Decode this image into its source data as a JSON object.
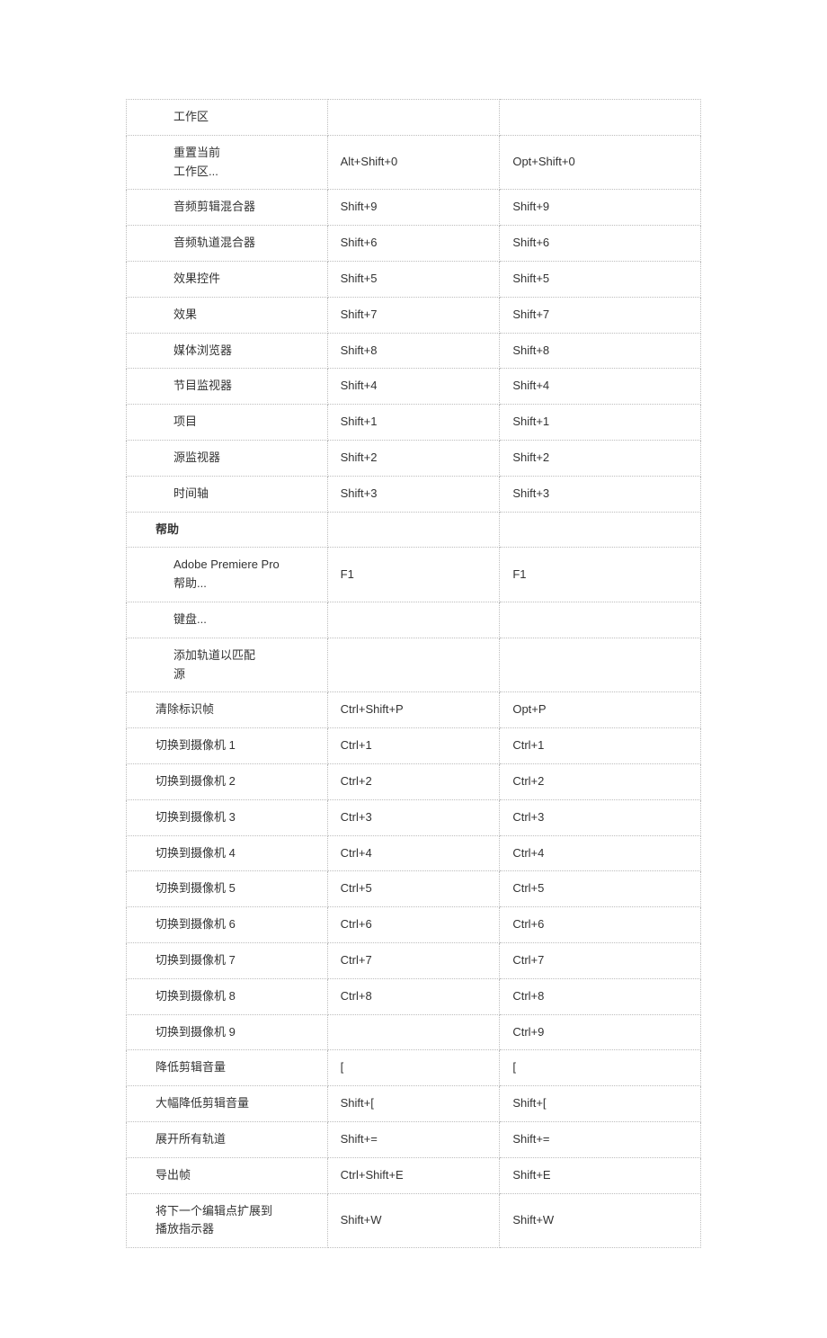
{
  "rows": [
    {
      "label": "工作区",
      "indent": 2,
      "win": "",
      "mac": ""
    },
    {
      "label": "重置当前\n工作区...",
      "indent": 2,
      "win": "Alt+Shift+0",
      "mac": "Opt+Shift+0"
    },
    {
      "label": "音频剪辑混合器",
      "indent": 2,
      "win": "Shift+9",
      "mac": "Shift+9"
    },
    {
      "label": "音频轨道混合器",
      "indent": 2,
      "win": "Shift+6",
      "mac": "Shift+6"
    },
    {
      "label": "效果控件",
      "indent": 2,
      "win": "Shift+5",
      "mac": "Shift+5"
    },
    {
      "label": "效果",
      "indent": 2,
      "win": "Shift+7",
      "mac": "Shift+7"
    },
    {
      "label": "媒体浏览器",
      "indent": 2,
      "win": "Shift+8",
      "mac": "Shift+8"
    },
    {
      "label": "节目监视器",
      "indent": 2,
      "win": "Shift+4",
      "mac": "Shift+4"
    },
    {
      "label": "项目",
      "indent": 2,
      "win": "Shift+1",
      "mac": "Shift+1"
    },
    {
      "label": "源监视器",
      "indent": 2,
      "win": "Shift+2",
      "mac": "Shift+2"
    },
    {
      "label": "时间轴",
      "indent": 2,
      "win": "Shift+3",
      "mac": "Shift+3"
    },
    {
      "label": "帮助",
      "indent": 1,
      "win": "",
      "mac": "",
      "bold": true
    },
    {
      "label": "Adobe Premiere Pro\n帮助...",
      "indent": 2,
      "win": "F1",
      "mac": "F1"
    },
    {
      "label": "键盘...",
      "indent": 2,
      "win": "",
      "mac": ""
    },
    {
      "label": "添加轨道以匹配\n源",
      "indent": 2,
      "win": "",
      "mac": ""
    },
    {
      "label": "清除标识帧",
      "indent": 1,
      "win": "Ctrl+Shift+P",
      "mac": "Opt+P"
    },
    {
      "label": "切换到摄像机 1",
      "indent": 1,
      "win": "Ctrl+1",
      "mac": "Ctrl+1"
    },
    {
      "label": "切换到摄像机 2",
      "indent": 1,
      "win": "Ctrl+2",
      "mac": "Ctrl+2"
    },
    {
      "label": "切换到摄像机 3",
      "indent": 1,
      "win": "Ctrl+3",
      "mac": "Ctrl+3"
    },
    {
      "label": "切换到摄像机 4",
      "indent": 1,
      "win": "Ctrl+4",
      "mac": "Ctrl+4"
    },
    {
      "label": "切换到摄像机 5",
      "indent": 1,
      "win": "Ctrl+5",
      "mac": "Ctrl+5"
    },
    {
      "label": "切换到摄像机 6",
      "indent": 1,
      "win": "Ctrl+6",
      "mac": "Ctrl+6"
    },
    {
      "label": "切换到摄像机 7",
      "indent": 1,
      "win": "Ctrl+7",
      "mac": "Ctrl+7"
    },
    {
      "label": "切换到摄像机 8",
      "indent": 1,
      "win": "Ctrl+8",
      "mac": "Ctrl+8"
    },
    {
      "label": "切换到摄像机 9",
      "indent": 1,
      "win": "",
      "mac": "Ctrl+9"
    },
    {
      "label": "降低剪辑音量",
      "indent": 1,
      "win": "[",
      "mac": "["
    },
    {
      "label": "大幅降低剪辑音量",
      "indent": 1,
      "win": "Shift+[",
      "mac": "Shift+["
    },
    {
      "label": " 展开所有轨道",
      "indent": 1,
      "win": "Shift+=",
      "mac": "Shift+="
    },
    {
      "label": "导出帧",
      "indent": 1,
      "win": "Ctrl+Shift+E",
      "mac": "Shift+E"
    },
    {
      "label": "将下一个编辑点扩展到\n播放指示器",
      "indent": 1,
      "win": "Shift+W",
      "mac": "Shift+W"
    }
  ]
}
